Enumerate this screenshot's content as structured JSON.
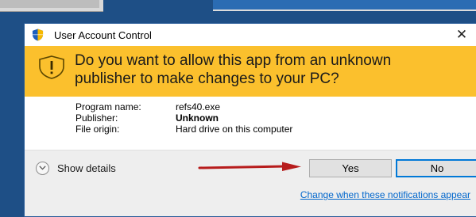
{
  "window": {
    "title": "User Account Control",
    "close_glyph": "✕"
  },
  "banner": {
    "question": "Do you want to allow this app from an unknown publisher to make changes to your PC?"
  },
  "details": [
    {
      "label": "Program name:",
      "value": "refs40.exe",
      "bold": false
    },
    {
      "label": "Publisher:",
      "value": "Unknown",
      "bold": true
    },
    {
      "label": "File origin:",
      "value": "Hard drive on this computer",
      "bold": false
    }
  ],
  "footer": {
    "show_details": "Show details",
    "yes": "Yes",
    "no": "No",
    "notifications_link": "Change when these notifications appear"
  },
  "icons": [
    "uac-shield-icon",
    "warning-shield-icon",
    "chevron-down-icon",
    "close-icon",
    "red-arrow-icon"
  ],
  "colors": {
    "banner": "#fbc02d",
    "link": "#0066cc",
    "focus_border": "#0078d7",
    "arrow": "#b71c1c"
  }
}
